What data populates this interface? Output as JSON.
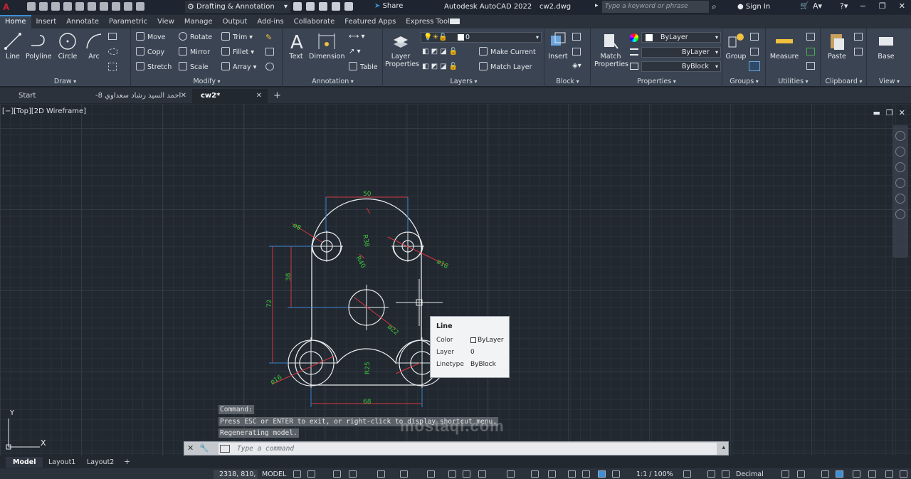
{
  "titlebar": {
    "logo": "A",
    "workspace": "Drafting & Annotation",
    "share": "Share",
    "app_title": "Autodesk AutoCAD 2022",
    "doc_name": "cw2.dwg",
    "search_placeholder": "Type a keyword or phrase",
    "signin": "Sign In"
  },
  "ribbon_tabs": [
    "Home",
    "Insert",
    "Annotate",
    "Parametric",
    "View",
    "Manage",
    "Output",
    "Add-ins",
    "Collaborate",
    "Featured Apps",
    "Express Tools"
  ],
  "ribbon": {
    "draw": {
      "title": "Draw",
      "line": "Line",
      "polyline": "Polyline",
      "circle": "Circle",
      "arc": "Arc"
    },
    "modify": {
      "title": "Modify",
      "move": "Move",
      "rotate": "Rotate",
      "trim": "Trim",
      "copy": "Copy",
      "mirror": "Mirror",
      "fillet": "Fillet",
      "stretch": "Stretch",
      "scale": "Scale",
      "array": "Array"
    },
    "annotation": {
      "title": "Annotation",
      "text": "Text",
      "dimension": "Dimension",
      "table": "Table"
    },
    "layers": {
      "title": "Layers",
      "layer_properties": "Layer Properties",
      "current_layer": "0",
      "make_current": "Make Current",
      "match_layer": "Match Layer"
    },
    "block": {
      "title": "Block",
      "insert": "Insert"
    },
    "properties": {
      "title": "Properties",
      "match_properties": "Match Properties",
      "color": "ByLayer",
      "linetype": "ByLayer",
      "lineweight": "ByBlock"
    },
    "groups": {
      "title": "Groups",
      "group": "Group"
    },
    "utilities": {
      "title": "Utilities",
      "measure": "Measure"
    },
    "clipboard": {
      "title": "Clipboard",
      "paste": "Paste"
    },
    "view": {
      "title": "View",
      "base": "Base"
    }
  },
  "doc_tabs": [
    {
      "label": "Start"
    },
    {
      "label": "احمد السيد رشاد سعداوي 8-"
    },
    {
      "label": "cw2*"
    }
  ],
  "viewport": {
    "label": "[−][Top][2D Wireframe]"
  },
  "drawing": {
    "dims": {
      "top_width": "50",
      "bottom_width": "68",
      "left_height": "72",
      "mid_height": "38",
      "d8": "ø8",
      "d18": "ø18",
      "d22": "ø22",
      "d16": "ø16",
      "r38": "R38",
      "r40": "R40",
      "r25": "R25"
    }
  },
  "tooltip": {
    "title": "Line",
    "color_label": "Color",
    "color_value": "ByLayer",
    "layer_label": "Layer",
    "layer_value": "0",
    "linetype_label": "Linetype",
    "linetype_value": "ByBlock"
  },
  "command_history": [
    "Command:",
    "Press ESC or ENTER to exit, or right-click to display shortcut menu.",
    "Regenerating model."
  ],
  "command_line": {
    "placeholder": "Type a command"
  },
  "watermark": "mostaql.com",
  "ucs": {
    "x": "X",
    "y": "Y"
  },
  "layout_tabs": [
    "Model",
    "Layout1",
    "Layout2"
  ],
  "status": {
    "coords": "2318, 810, 0",
    "model": "MODEL",
    "scale": "1:1 / 100%",
    "units": "Decimal"
  }
}
